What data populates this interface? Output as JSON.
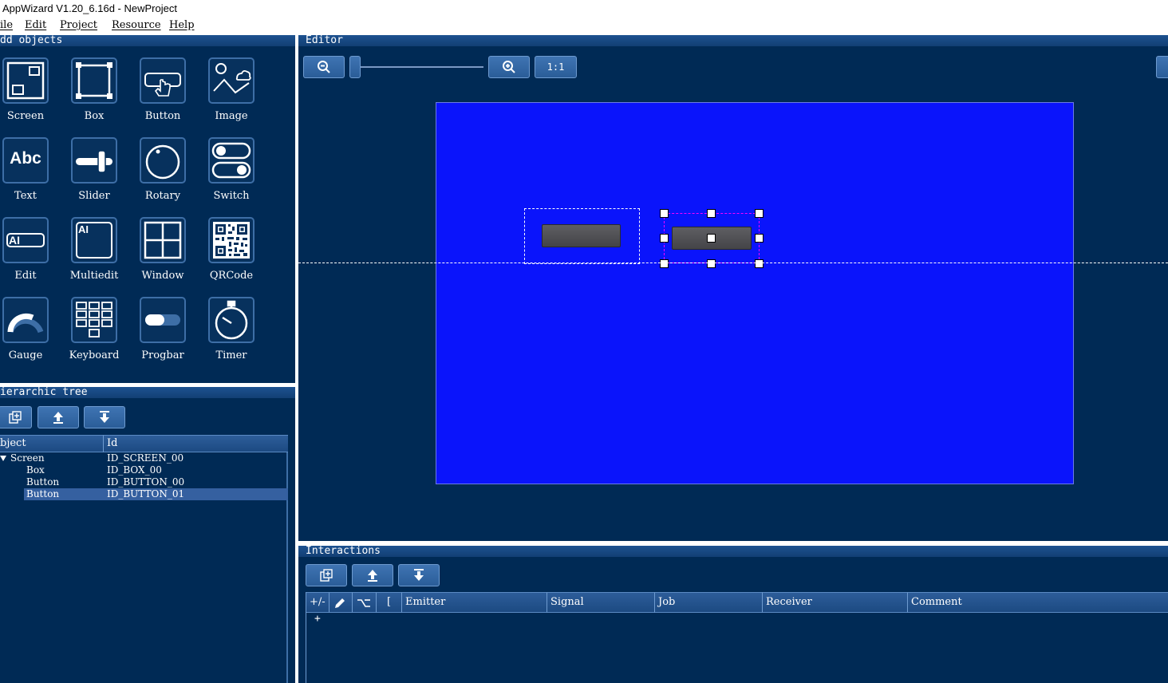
{
  "window": {
    "title": "AppWizard V1.20_6.16d - NewProject"
  },
  "menu": {
    "items": [
      "ile",
      "Edit",
      "Project",
      "Resource",
      "Help"
    ]
  },
  "add_objects": {
    "title": "dd objects",
    "items": [
      {
        "label": "Screen",
        "icon": "screen-icon"
      },
      {
        "label": "Box",
        "icon": "box-icon"
      },
      {
        "label": "Button",
        "icon": "button-icon"
      },
      {
        "label": "Image",
        "icon": "image-icon"
      },
      {
        "label": "Text",
        "icon": "text-icon"
      },
      {
        "label": "Slider",
        "icon": "slider-icon"
      },
      {
        "label": "Rotary",
        "icon": "rotary-icon"
      },
      {
        "label": "Switch",
        "icon": "switch-icon"
      },
      {
        "label": "Edit",
        "icon": "edit-icon"
      },
      {
        "label": "Multiedit",
        "icon": "multiedit-icon"
      },
      {
        "label": "Window",
        "icon": "window-icon"
      },
      {
        "label": "QRCode",
        "icon": "qrcode-icon"
      },
      {
        "label": "Gauge",
        "icon": "gauge-icon"
      },
      {
        "label": "Keyboard",
        "icon": "keyboard-icon"
      },
      {
        "label": "Progbar",
        "icon": "progbar-icon"
      },
      {
        "label": "Timer",
        "icon": "timer-icon"
      }
    ],
    "text_icon_glyph": "Abc",
    "edit_icon_glyph": "AI",
    "multiedit_icon_glyph": "AI"
  },
  "tree": {
    "title": "ierarchic tree",
    "columns": [
      "bject",
      "Id"
    ],
    "rows": [
      {
        "object": "Screen",
        "id": "ID_SCREEN_00",
        "level": 0,
        "expanded": true,
        "selected": false
      },
      {
        "object": "Box",
        "id": "ID_BOX_00",
        "level": 1,
        "selected": false
      },
      {
        "object": "Button",
        "id": "ID_BUTTON_00",
        "level": 1,
        "selected": false
      },
      {
        "object": "Button",
        "id": "ID_BUTTON_01",
        "level": 1,
        "selected": true
      }
    ]
  },
  "editor": {
    "title": "Editor",
    "zoom_reset_label": "1:1"
  },
  "interactions": {
    "title": "Interactions",
    "columns": [
      "+/-",
      "",
      "",
      "[",
      "Emitter",
      "Signal",
      "Job",
      "Receiver",
      "Comment"
    ],
    "add_row_label": "+"
  },
  "colors": {
    "background": "#002a55",
    "canvas": "#0a14fb",
    "panel_header": "#1d5290",
    "selection": "#ff00ff"
  }
}
